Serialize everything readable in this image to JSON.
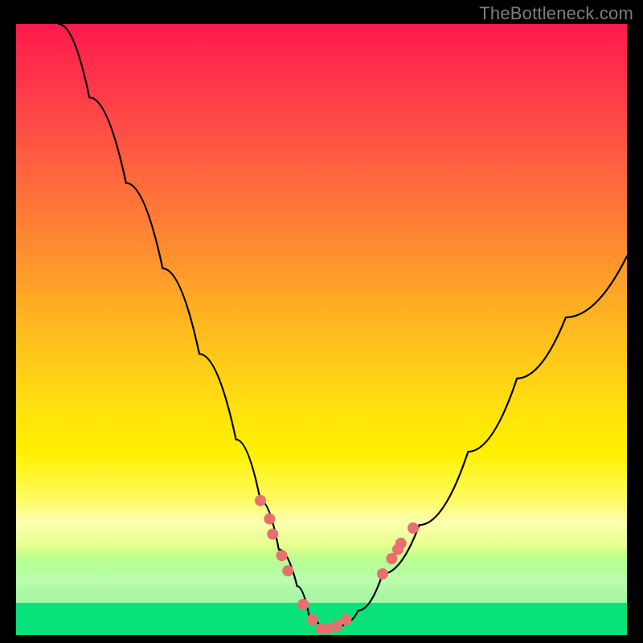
{
  "watermark": "TheBottleneck.com",
  "chart_data": {
    "type": "line",
    "title": "",
    "xlabel": "",
    "ylabel": "",
    "xlim": [
      0,
      100
    ],
    "ylim": [
      0,
      100
    ],
    "grid": false,
    "legend": false,
    "series": [
      {
        "name": "bottleneck-curve",
        "x": [
          7,
          12,
          18,
          24,
          30,
          36,
          40,
          43,
          46,
          48,
          50,
          52,
          54,
          56,
          60,
          66,
          74,
          82,
          90,
          100
        ],
        "y": [
          100,
          88,
          74,
          60,
          46,
          32,
          22,
          14,
          8,
          3,
          1,
          1,
          2,
          4,
          10,
          18,
          30,
          42,
          52,
          62
        ]
      }
    ],
    "markers": {
      "name": "highlight-dots",
      "x": [
        40.0,
        41.5,
        42.0,
        43.5,
        44.5,
        47.0,
        48.5,
        50.0,
        51.0,
        52.5,
        54.0,
        60.0,
        61.5,
        63.0,
        62.5,
        65.0
      ],
      "y": [
        22.0,
        19.0,
        16.5,
        13.0,
        10.5,
        5.0,
        2.5,
        1.0,
        1.0,
        1.5,
        2.5,
        10.0,
        12.5,
        15.0,
        14.0,
        17.5
      ]
    },
    "background": {
      "type": "vertical-gradient",
      "stops": [
        {
          "pos": 0.0,
          "color": "#ff1a4d"
        },
        {
          "pos": 0.5,
          "color": "#ffc018"
        },
        {
          "pos": 0.8,
          "color": "#fff040"
        },
        {
          "pos": 1.0,
          "color": "#09e27a"
        }
      ]
    }
  }
}
